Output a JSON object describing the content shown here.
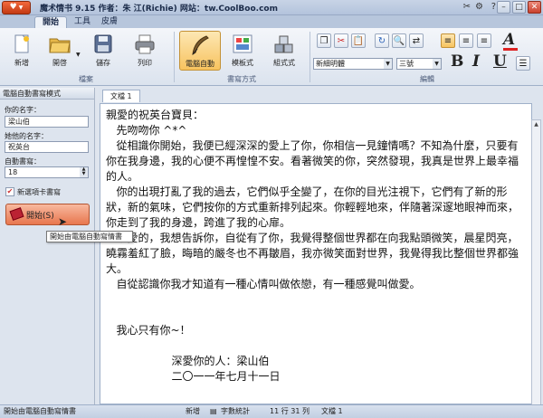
{
  "window": {
    "title": "魔术情书 9.15   作者：朱 江(Richie)   网站：tw.CoolBoo.com"
  },
  "ribbon": {
    "tabs": [
      "開始",
      "工具",
      "皮膚"
    ],
    "groups": {
      "file": {
        "label": "檔案",
        "buttons": [
          "新增",
          "開啓",
          "儲存",
          "列印"
        ]
      },
      "writing": {
        "label": "書寫方式",
        "buttons": [
          "電腦自動",
          "模板式",
          "組式式"
        ]
      },
      "edit": {
        "label": "編輯",
        "font_name": "新細明體",
        "font_size": "三號",
        "format": [
          "B",
          "I",
          "U"
        ]
      }
    }
  },
  "left_panel": {
    "title": "電腦自動書寫模式",
    "your_name_label": "你的名字：",
    "your_name_value": "梁山伯",
    "her_name_label": "她他的名字：",
    "her_name_value": "祝英台",
    "auto_write_label": "自動書寫：",
    "auto_write_value": "18",
    "new_tab_label": "新選項卡書寫",
    "start_label": "開始(S)",
    "tooltip": "開始由電腦自動寫情書"
  },
  "editor": {
    "tab_label": "文檔 1",
    "lines": [
      "親愛的祝英台寶貝：",
      "   先吻吻你 ^*^",
      "   從相識你開始，我便已經深深的愛上了你，你相信一見鐘情嗎？不知為什麼，只要有你在我身邊，我的心便不再惶惶不安。看著微笑的你，突然發現，我真是世界上最幸福的人。",
      "   你的出現打亂了我的過去，它們似乎全變了，在你的目光注視下，它們有了新的形狀，新的氣味，它們按你的方式重新排列起來。你輕輕地來，伴隨著深邃地眼神而來，你走到了我的身邊，跨進了我的心扉。",
      "   親愛的，我想告訴你，自從有了你，我覺得整個世界都在向我點頭微笑，晨星閃亮，曉霧羞紅了臉，晦暗的嚴冬也不再皺眉，我亦微笑面對世界，我覺得我比整個世界都強大。",
      "   自從認識你我才知道有一種心情叫做依戀，有一種感覺叫做愛。",
      "",
      "",
      "   我心只有你~！",
      "",
      "                   深愛你的人：梁山伯",
      "                   二〇一一年七月十一日"
    ]
  },
  "statusbar": {
    "message": "開始由電腦自動寫情書",
    "mode": "新增",
    "word_count": "字數統計",
    "position": "11 行  31 列",
    "doc": "文檔 1"
  }
}
